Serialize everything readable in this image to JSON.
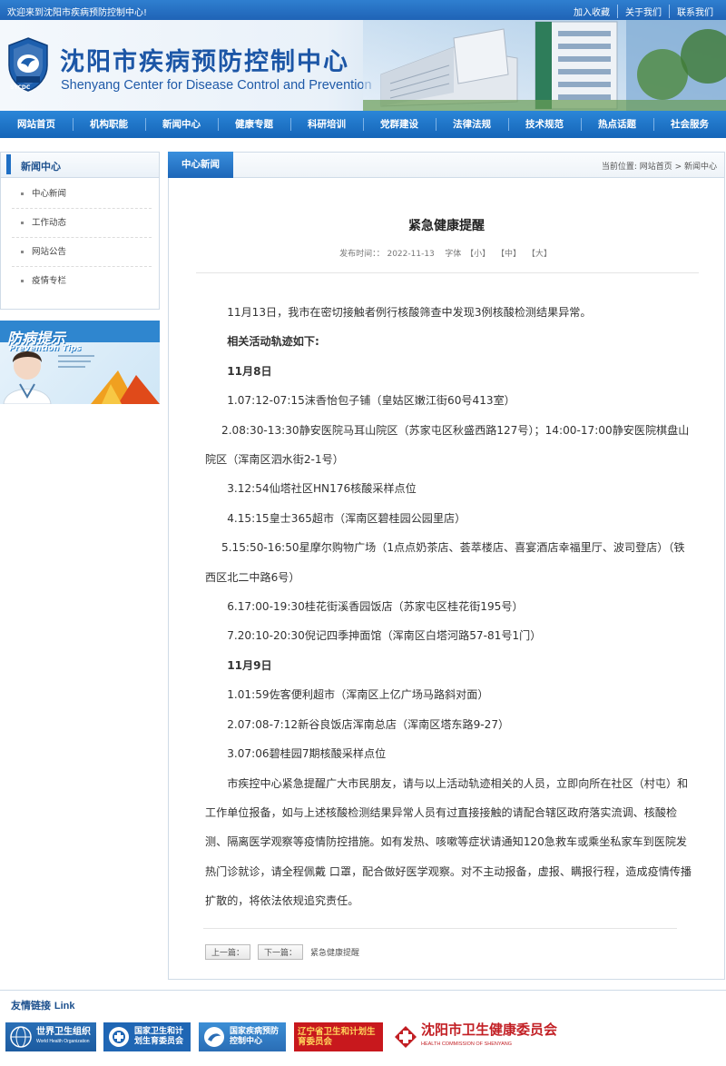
{
  "topbar": {
    "welcome": "欢迎来到沈阳市疾病预防控制中心!",
    "links": [
      "加入收藏",
      "关于我们",
      "联系我们"
    ]
  },
  "header": {
    "title_cn": "沈阳市疾病预防控制中心",
    "title_en": "Shenyang Center for Disease Control and Prevention",
    "logo_text": "SYCDC"
  },
  "nav": [
    "网站首页",
    "机构职能",
    "新闻中心",
    "健康专题",
    "科研培训",
    "党群建设",
    "法律法规",
    "技术规范",
    "热点话题",
    "社会服务"
  ],
  "sidebar": {
    "title": "新闻中心",
    "items": [
      "中心新闻",
      "工作动态",
      "网站公告",
      "疫情专栏"
    ],
    "promo": {
      "title": "防病提示",
      "subtitle": "Prevention Tips"
    }
  },
  "main": {
    "tab": "中心新闻",
    "breadcrumb": "当前位置:  网站首页 > 新闻中心",
    "article": {
      "title": "紧急健康提醒",
      "meta_prefix": "发布时间：：",
      "date": "2022-11-13",
      "font_label": "字体",
      "font_sizes": [
        "【小】",
        "【中】",
        "【大】"
      ],
      "paragraphs": [
        {
          "text": "11月13日，我市在密切接触者例行核酸筛查中发现3例核酸检测结果异常。",
          "style": "normal"
        },
        {
          "text": "相关活动轨迹如下:",
          "style": "sub"
        },
        {
          "text": "11月8日",
          "style": "sub"
        },
        {
          "text": "1.07:12-07:15沫香怡包子铺（皇姑区嫩江街60号413室）",
          "style": "normal"
        },
        {
          "text": "2.08:30-13:30静安医院马耳山院区（苏家屯区秋盛西路127号）；14:00-17:00静安医院棋盘山院区（浑南区泗水街2-1号）",
          "style": "wrap"
        },
        {
          "text": "3.12:54仙塔社区HN176核酸采样点位",
          "style": "normal"
        },
        {
          "text": "4.15:15皇士365超市（浑南区碧桂园公园里店）",
          "style": "normal"
        },
        {
          "text": "5.15:50-16:50星摩尔购物广场（1点点奶茶店、荟萃楼店、喜宴酒店幸福里厅、波司登店）（铁西区北二中路6号）",
          "style": "wrap"
        },
        {
          "text": "6.17:00-19:30桂花街溪香园饭店（苏家屯区桂花街195号）",
          "style": "normal"
        },
        {
          "text": "7.20:10-20:30倪记四季抻面馆（浑南区白塔河路57-81号1门）",
          "style": "normal"
        },
        {
          "text": "11月9日",
          "style": "sub"
        },
        {
          "text": "1.01:59佐客便利超市（浑南区上亿广场马路斜对面）",
          "style": "normal"
        },
        {
          "text": "2.07:08-7:12新谷良饭店浑南总店（浑南区塔东路9-27）",
          "style": "normal"
        },
        {
          "text": "3.07:06碧桂园7期核酸采样点位",
          "style": "normal"
        },
        {
          "text": "市疾控中心紧急提醒广大市民朋友，请与以上活动轨迹相关的人员，立即向所在社区（村屯）和工作单位报备，如与上述核酸检测结果异常人员有过直接接触的请配合辖区政府落实流调、核酸检测、隔离医学观察等疫情防控措施。如有发热、咳嗽等症状请通知120急救车或乘坐私家车到医院发热门诊就诊，请全程佩戴 口罩，配合做好医学观察。对不主动报备，虚报、瞒报行程，造成疫情传播扩散的，将依法依规追究责任。",
          "style": "normal"
        }
      ]
    },
    "pager": {
      "prev": "上一篇：",
      "next": "下一篇：",
      "current": "紧急健康提醒"
    }
  },
  "friend_links": {
    "title": "友情链接",
    "title_en": "Link",
    "items": [
      {
        "name": "世界卫生组织",
        "sub": "World Health Organization"
      },
      {
        "name": "国家卫生和计划生育委员会",
        "sub": ""
      },
      {
        "name": "国家疾病预防控制中心",
        "sub": ""
      },
      {
        "name": "辽宁省卫生和计划生育委员会",
        "sub": ""
      },
      {
        "name": "沈阳市卫生健康委员会",
        "sub": "HEALTH COMMISSION OF SHENYANG"
      }
    ]
  },
  "colors": {
    "brand_blue": "#1f63b6",
    "nav_blue": "#1565b8",
    "title_blue": "#1c56a6",
    "red": "#c8181d"
  }
}
